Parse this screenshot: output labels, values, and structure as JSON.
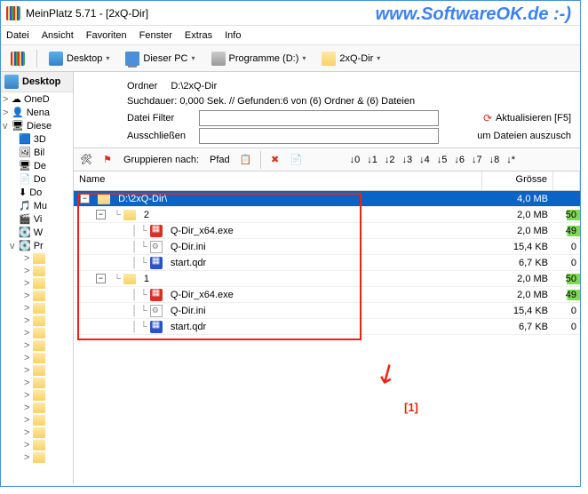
{
  "window": {
    "title": "MeinPlatz 5.71 - [2xQ-Dir]"
  },
  "watermark": "www.SoftwareOK.de :-)",
  "menu": [
    "Datei",
    "Ansicht",
    "Favoriten",
    "Fenster",
    "Extras",
    "Info"
  ],
  "breadcrumb": [
    {
      "icon": "desktop",
      "label": "Desktop"
    },
    {
      "icon": "pc",
      "label": "Dieser PC"
    },
    {
      "icon": "drive",
      "label": "Programme (D:)"
    },
    {
      "icon": "folder",
      "label": "2xQ-Dir"
    }
  ],
  "sidebar": {
    "header": "Desktop",
    "items": [
      {
        "icon": "cloud",
        "label": "OneD",
        "toggle": ">"
      },
      {
        "icon": "user",
        "label": "Nena",
        "toggle": ">"
      },
      {
        "icon": "pc",
        "label": "Diese",
        "toggle": "v",
        "children": [
          {
            "icon": "3d",
            "label": "3D"
          },
          {
            "icon": "pic",
            "label": "Bil"
          },
          {
            "icon": "desktop",
            "label": "De"
          },
          {
            "icon": "doc",
            "label": "Do"
          },
          {
            "icon": "dl",
            "label": "Do"
          },
          {
            "icon": "music",
            "label": "Mu"
          },
          {
            "icon": "video",
            "label": "Vi"
          },
          {
            "icon": "drive",
            "label": "W"
          },
          {
            "icon": "drive",
            "label": "Pr",
            "toggle": "v"
          }
        ]
      }
    ],
    "deep_folders_count": 17
  },
  "info": {
    "folder_label": "Ordner",
    "folder_path": "D:\\2xQ-Dir",
    "search_stats": "Suchdauer: 0,000 Sek. //  Gefunden:6 von (6) Ordner & (6) Dateien",
    "filter_label": "Datei Filter",
    "filter_value": "",
    "exclude_label": "Ausschließen",
    "exclude_value": "",
    "refresh": "Aktualisieren [F5]",
    "exclude_hint": "um Dateien auszusch"
  },
  "toolbar2": {
    "group_label": "Gruppieren nach:",
    "group_value": "Pfad",
    "depth_buttons": [
      "↓0",
      "↓1",
      "↓2",
      "↓3",
      "↓4",
      "↓5",
      "↓6",
      "↓7",
      "↓8",
      "↓*"
    ]
  },
  "columns": {
    "name": "Name",
    "size": "Grösse"
  },
  "rows": [
    {
      "depth": 0,
      "expander": "-",
      "icon": "folder",
      "name": "D:\\2xQ-Dir\\",
      "size": "4,0 MB",
      "pct": "",
      "selected": true
    },
    {
      "depth": 1,
      "expander": "-",
      "icon": "folder",
      "name": "2",
      "size": "2,0 MB",
      "pct": "50"
    },
    {
      "depth": 2,
      "icon": "exe",
      "name": "Q-Dir_x64.exe",
      "size": "2,0 MB",
      "pct": "49"
    },
    {
      "depth": 2,
      "icon": "ini",
      "name": "Q-Dir.ini",
      "size": "15,4 KB",
      "pct": "0"
    },
    {
      "depth": 2,
      "icon": "qdr",
      "name": "start.qdr",
      "size": "6,7 KB",
      "pct": "0"
    },
    {
      "depth": 1,
      "expander": "-",
      "icon": "folder",
      "name": "1",
      "size": "2,0 MB",
      "pct": "50"
    },
    {
      "depth": 2,
      "icon": "exe",
      "name": "Q-Dir_x64.exe",
      "size": "2,0 MB",
      "pct": "49"
    },
    {
      "depth": 2,
      "icon": "ini",
      "name": "Q-Dir.ini",
      "size": "15,4 KB",
      "pct": "0"
    },
    {
      "depth": 2,
      "icon": "qdr",
      "name": "start.qdr",
      "size": "6,7 KB",
      "pct": "0"
    }
  ],
  "annotation": {
    "label": "[1]"
  }
}
